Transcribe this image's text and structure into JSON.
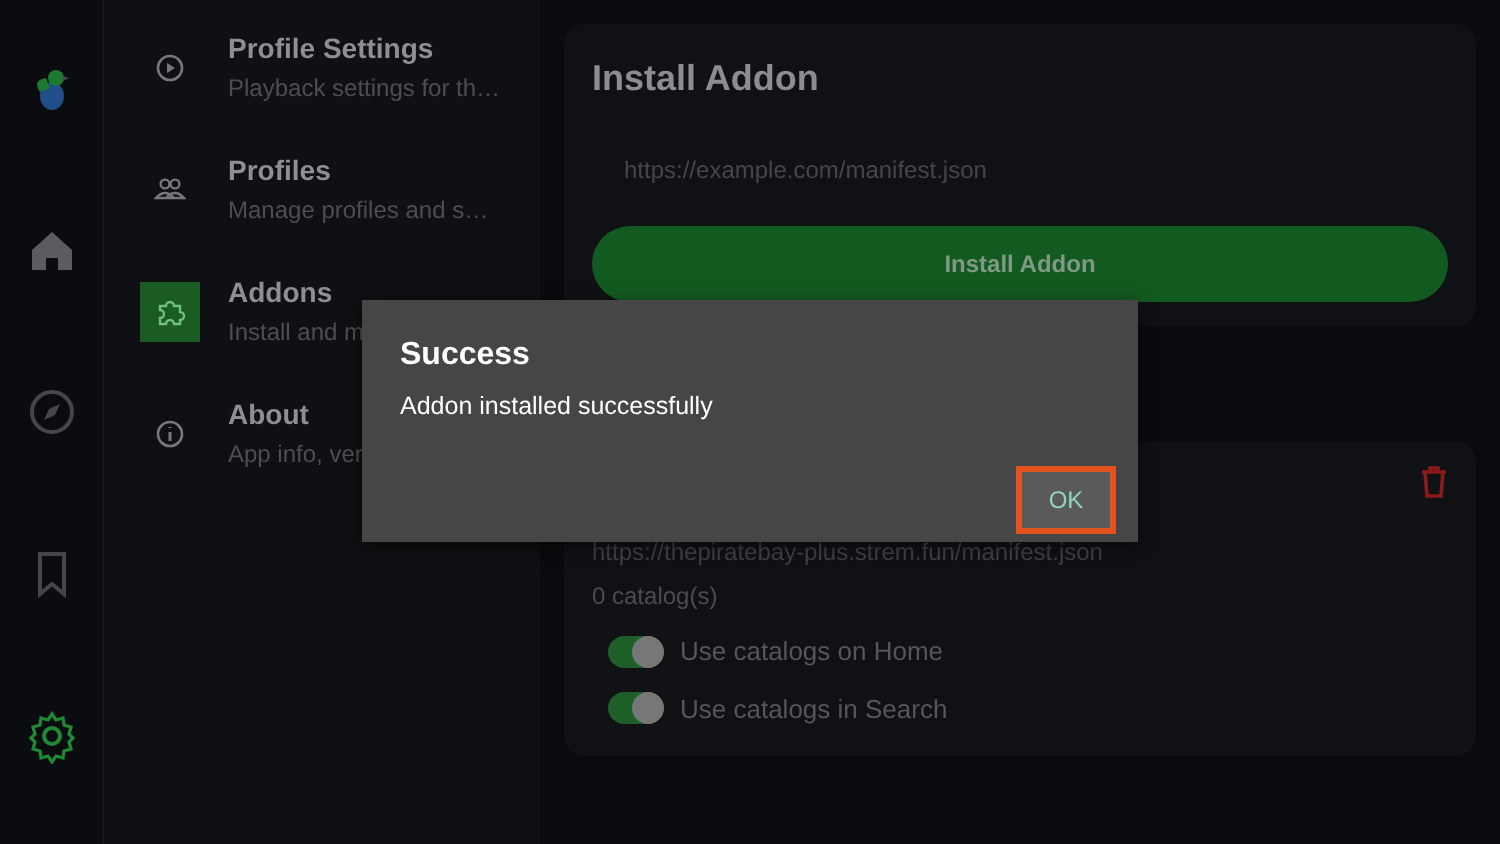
{
  "rail": {
    "items": [
      {
        "kind": "logo",
        "selected": false
      },
      {
        "kind": "home",
        "selected": false
      },
      {
        "kind": "compass",
        "selected": false
      },
      {
        "kind": "bookmark",
        "selected": false
      },
      {
        "kind": "gear",
        "selected": true
      }
    ]
  },
  "settings_menu": {
    "items": [
      {
        "kind": "play",
        "title": "Profile Settings",
        "subtitle": "Playback settings for th…",
        "selected": false
      },
      {
        "kind": "people",
        "title": "Profiles",
        "subtitle": "Manage profiles and s…",
        "selected": false
      },
      {
        "kind": "puzzle",
        "title": "Addons",
        "subtitle": "Install and m",
        "selected": true
      },
      {
        "kind": "info",
        "title": "About",
        "subtitle": "App info, ver",
        "selected": false
      }
    ]
  },
  "install_card": {
    "title": "Install Addon",
    "placeholder": "https://example.com/manifest.json",
    "button": "Install Addon"
  },
  "addon_card": {
    "url": "https://thepiratebay-plus.strem.fun/manifest.json",
    "catalogs": "0 catalog(s)",
    "toggles": [
      {
        "label": "Use catalogs on Home",
        "on": true
      },
      {
        "label": "Use catalogs in Search",
        "on": true
      }
    ]
  },
  "dialog": {
    "title": "Success",
    "message": "Addon installed successfully",
    "button": "OK",
    "focused": true
  }
}
